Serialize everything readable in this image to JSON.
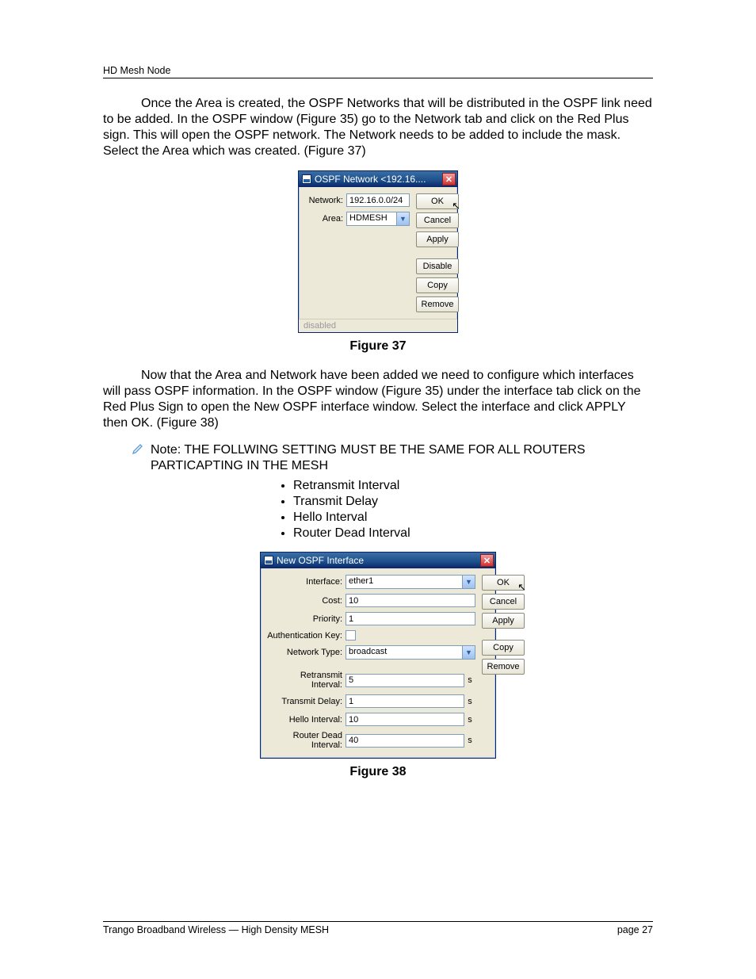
{
  "header": "HD Mesh Node",
  "para1": "Once the Area is created, the OSPF Networks that will be distributed in the OSPF link need to be added. In the OSPF window (Figure 35) go to the Network tab and click on the Red Plus sign. This will open the OSPF network. The Network needs to be added to include the mask. Select the Area which was created. (Figure 37)",
  "fig37": {
    "title": "OSPF Network <192.16....",
    "network_label": "Network:",
    "network_value": "192.16.0.0/24",
    "area_label": "Area:",
    "area_value": "HDMESH",
    "buttons": {
      "ok": "OK",
      "cancel": "Cancel",
      "apply": "Apply",
      "disable": "Disable",
      "copy": "Copy",
      "remove": "Remove"
    },
    "status": "disabled",
    "caption": "Figure 37"
  },
  "para2": "Now that the Area and Network have been added we need to configure which interfaces will pass OSPF information. In the OSPF window (Figure 35) under the interface tab click on the Red Plus Sign to open the New OSPF interface window. Select the interface and click APPLY then OK. (Figure 38)",
  "note": "Note: THE FOLLWING SETTING MUST BE THE SAME FOR ALL ROUTERS PARTICAPTING IN THE MESH",
  "settings_list": [
    "Retransmit Interval",
    "Transmit Delay",
    "Hello Interval",
    "Router Dead Interval"
  ],
  "fig38": {
    "title": "New OSPF Interface",
    "rows": {
      "interface": {
        "label": "Interface:",
        "value": "ether1"
      },
      "cost": {
        "label": "Cost:",
        "value": "10"
      },
      "priority": {
        "label": "Priority:",
        "value": "1"
      },
      "auth": {
        "label": "Authentication Key:"
      },
      "nettype": {
        "label": "Network Type:",
        "value": "broadcast"
      },
      "retransmit": {
        "label": "Retransmit Interval:",
        "value": "5",
        "unit": "s"
      },
      "txdelay": {
        "label": "Transmit Delay:",
        "value": "1",
        "unit": "s"
      },
      "hello": {
        "label": "Hello Interval:",
        "value": "10",
        "unit": "s"
      },
      "dead": {
        "label": "Router Dead Interval:",
        "value": "40",
        "unit": "s"
      }
    },
    "buttons": {
      "ok": "OK",
      "cancel": "Cancel",
      "apply": "Apply",
      "copy": "Copy",
      "remove": "Remove"
    },
    "caption": "Figure 38"
  },
  "footer": {
    "left": "Trango Broadband Wireless — High Density MESH",
    "right": "page 27"
  }
}
